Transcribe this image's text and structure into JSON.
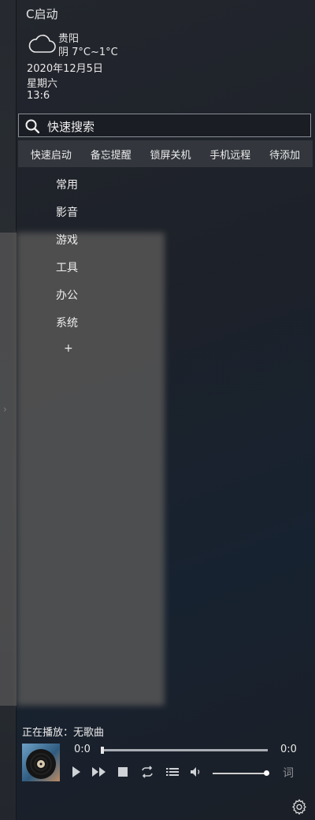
{
  "app": {
    "title": "C启动"
  },
  "weather": {
    "city": "贵阳",
    "condition": "阴  7°C~1°C",
    "icon": "cloud-icon"
  },
  "datetime": {
    "date": "2020年12月5日",
    "weekday": "星期六",
    "time": "13:6"
  },
  "search": {
    "placeholder": "快速搜索"
  },
  "quickbar": {
    "items": [
      "快速启动",
      "备忘提醒",
      "锁屏关机",
      "手机远程",
      "待添加"
    ]
  },
  "categories": {
    "items": [
      "常用",
      "影音",
      "游戏",
      "工具",
      "办公",
      "系统"
    ],
    "add_label": "+"
  },
  "player": {
    "now_playing": "正在播放：无歌曲",
    "time_elapsed": "0:0",
    "time_total": "0:0",
    "lyrics_label": "词",
    "progress": 0,
    "volume": 1
  },
  "colors": {
    "accent": "#33373d",
    "panel": "#1d2129"
  }
}
